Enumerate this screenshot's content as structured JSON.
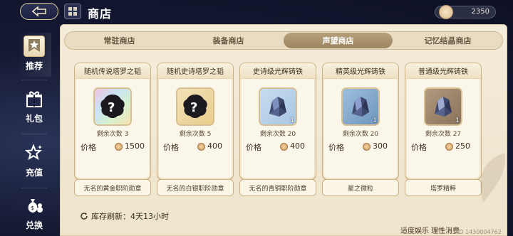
{
  "header": {
    "title": "商店",
    "currency_amount": "2350"
  },
  "sidebar": {
    "items": [
      {
        "label": "推荐",
        "icon": "star-badge-icon",
        "active": true
      },
      {
        "label": "礼包",
        "icon": "gift-icon",
        "active": false
      },
      {
        "label": "充值",
        "icon": "sparkle-star-icon",
        "active": false
      },
      {
        "label": "兑换",
        "icon": "money-bag-icon",
        "active": false
      }
    ]
  },
  "tabs": [
    {
      "label": "常驻商店",
      "active": false
    },
    {
      "label": "装备商店",
      "active": false
    },
    {
      "label": "声望商店",
      "active": true
    },
    {
      "label": "记忆结晶商店",
      "active": false
    }
  ],
  "cards": [
    {
      "title": "随机传说塔罗之韬",
      "icon": "mystery-card-icon",
      "count": "",
      "remaining": "剩余次数 3",
      "price_label": "价格",
      "price": "1500"
    },
    {
      "title": "随机史诗塔罗之韬",
      "icon": "mystery-card-icon",
      "count": "",
      "remaining": "剩余次数 5",
      "price_label": "价格",
      "price": "400"
    },
    {
      "title": "史诗级光辉铸铁",
      "icon": "crystal-ore-icon",
      "count": "1",
      "remaining": "剩余次数 20",
      "price_label": "价格",
      "price": "400"
    },
    {
      "title": "精英级光辉铸铁",
      "icon": "crystal-ore-icon",
      "count": "1",
      "remaining": "剩余次数 20",
      "price_label": "价格",
      "price": "300"
    },
    {
      "title": "普通级光辉铸铁",
      "icon": "crystal-ore-icon",
      "count": "1",
      "remaining": "剩余次数 27",
      "price_label": "价格",
      "price": "250"
    }
  ],
  "bottom_items": [
    {
      "label": "无名的黄金职阶勋章"
    },
    {
      "label": "无名的白银职阶勋章"
    },
    {
      "label": "无名的青铜职阶勋章"
    },
    {
      "label": "星之微粒"
    },
    {
      "label": "塔罗精粹"
    }
  ],
  "refresh_text": "库存刷新：4天13小时",
  "footer_note": "适度娱乐  理性消费",
  "uid_text": "UID 1430004762",
  "colors": {
    "accent": "#a38c66",
    "panel": "#f4ecda",
    "background": "#151a33"
  }
}
